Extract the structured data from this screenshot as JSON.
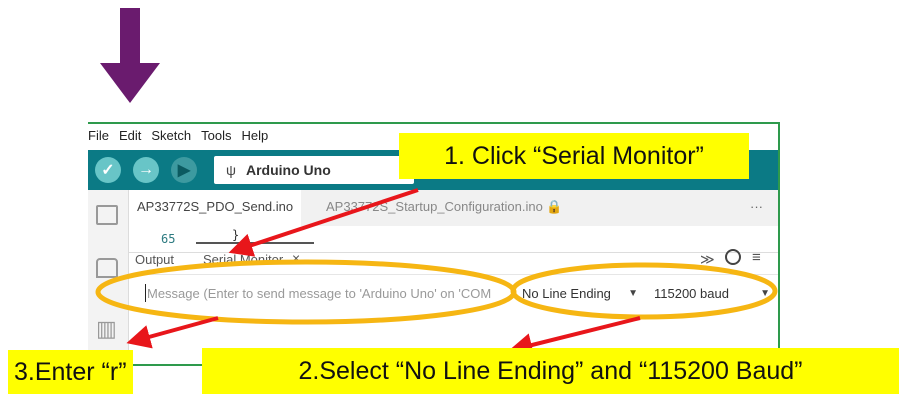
{
  "menu": [
    "File",
    "Edit",
    "Sketch",
    "Tools",
    "Help"
  ],
  "toolbar": {
    "board": "Arduino Uno",
    "usb_icon": "usb-icon"
  },
  "tabs": [
    "AP33772S_PDO_Send.ino",
    "AP33772S_Startup_Configuration.ino 🔒",
    "···"
  ],
  "editor": {
    "line_number": "65",
    "code_fragment": "}"
  },
  "panel": {
    "output_tab": "Output",
    "serial_tab": "Serial Monitor",
    "close": "×"
  },
  "serial": {
    "placeholder": "Message (Enter to send message to 'Arduino Uno' on 'COM",
    "line_ending": "No Line Ending",
    "baud": "115200 baud"
  },
  "callouts": {
    "step1": "1. Click “Serial Monitor”",
    "step2": "2.Select “No Line Ending” and “115200 Baud”",
    "step3": "3.Enter “r”"
  },
  "colors": {
    "arrow_purple": "#6a1b6e",
    "highlight_orange": "#f6b613",
    "callout_yellow": "#ffff00",
    "pointer_red": "#e8161b",
    "toolbar_teal": "#0b7a85"
  }
}
